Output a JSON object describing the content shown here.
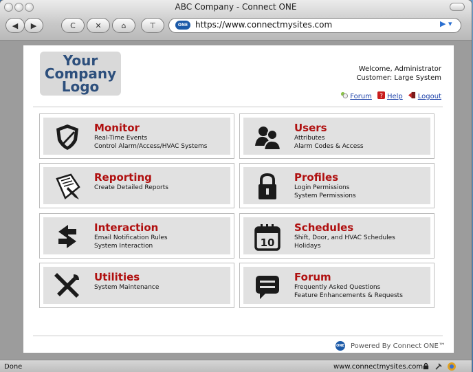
{
  "window": {
    "title": "ABC Company - Connect ONE"
  },
  "toolbar": {
    "back_label": "◀",
    "forward_label": "▶",
    "reload_label": "C",
    "stop_label": "✕",
    "home_label": "⌂",
    "bookmark_label": "⊤",
    "url_badge": "ONE",
    "url": "https://www.connectmysites.com",
    "go_label": "▶ ▾"
  },
  "header": {
    "logo_line1": "Your",
    "logo_line2": "Company",
    "logo_line3": "Logo",
    "welcome": "Welcome, Administrator",
    "customer": "Customer: Large System",
    "links": {
      "forum": "Forum",
      "help": "Help",
      "logout": "Logout"
    }
  },
  "tiles": [
    {
      "title": "Monitor",
      "lines": [
        "Real-Time Events",
        "Control Alarm/Access/HVAC Systems"
      ],
      "icon": "shield-icon"
    },
    {
      "title": "Users",
      "lines": [
        "Attributes",
        "Alarm Codes & Access"
      ],
      "icon": "users-icon"
    },
    {
      "title": "Reporting",
      "lines": [
        "Create Detailed Reports"
      ],
      "icon": "report-icon"
    },
    {
      "title": "Profiles",
      "lines": [
        "Login Permissions",
        "System Permissions"
      ],
      "icon": "lock-icon"
    },
    {
      "title": "Interaction",
      "lines": [
        "Email Notification Rules",
        "System Interaction"
      ],
      "icon": "arrows-icon"
    },
    {
      "title": "Schedules",
      "lines": [
        "Shift, Door, and HVAC Schedules",
        "Holidays"
      ],
      "icon": "calendar-icon",
      "calendar_day": "10"
    },
    {
      "title": "Utilities",
      "lines": [
        "System Maintenance"
      ],
      "icon": "tools-icon"
    },
    {
      "title": "Forum",
      "lines": [
        "Frequently Asked Questions",
        "Feature Enhancements & Requests"
      ],
      "icon": "chat-icon"
    }
  ],
  "footer": {
    "badge": "ONE",
    "powered": "Powered By Connect ONE™"
  },
  "status": {
    "left": "Done",
    "right": "www.connectmysites.com"
  },
  "colors": {
    "accent": "#b01010",
    "link": "#1a3fa8",
    "brand": "#1c5aa8"
  }
}
